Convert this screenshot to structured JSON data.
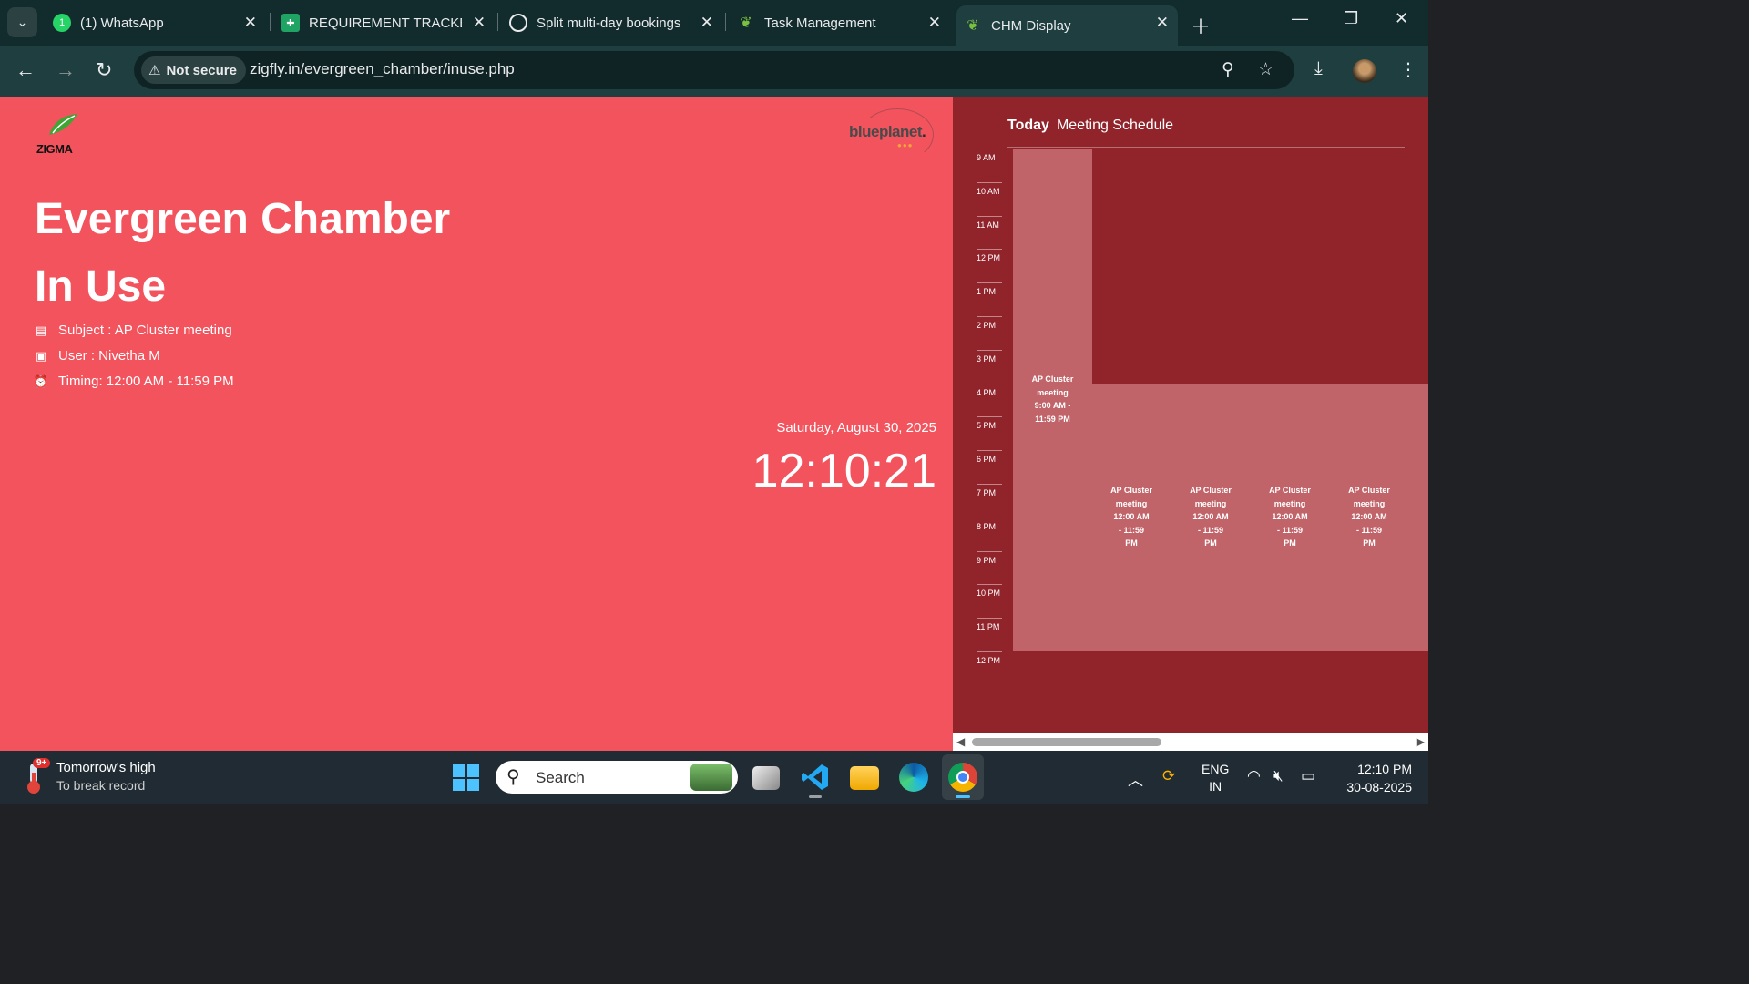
{
  "browser": {
    "tabs": [
      {
        "label": "(1) WhatsApp",
        "icon": "whatsapp-icon",
        "active": false
      },
      {
        "label": "REQUIREMENT TRACKER",
        "icon": "sheets-icon",
        "active": false
      },
      {
        "label": "Split multi-day bookings",
        "icon": "openai-icon",
        "active": false
      },
      {
        "label": "Task Management",
        "icon": "leaf-icon",
        "active": false
      },
      {
        "label": "CHM Display",
        "icon": "leaf-icon",
        "active": true
      }
    ],
    "security_label": "Not secure",
    "url": "zigfly.in/evergreen_chamber/inuse.php"
  },
  "page": {
    "brand_left": "ZIGMA",
    "brand_right": "blueplanet",
    "brand_right_dot": ".",
    "room_name": "Evergreen Chamber",
    "status": "In Use",
    "subject": "Subject : AP Cluster meeting",
    "user": "User : Nivetha M",
    "timing": "Timing: 12:00 AM - 11:59 PM",
    "date": "Saturday, August 30, 2025",
    "time": "12:10:21"
  },
  "schedule": {
    "today_label": "Today",
    "title": "Meeting Schedule",
    "hours": [
      "9 AM",
      "10 AM",
      "11 AM",
      "12 PM",
      "1 PM",
      "2 PM",
      "3 PM",
      "4 PM",
      "5 PM",
      "6 PM",
      "7 PM",
      "8 PM",
      "9 PM",
      "10 PM",
      "11 PM",
      "12 PM"
    ],
    "events": [
      {
        "title": "AP Cluster meeting",
        "time": "9:00 AM - 11:59 PM",
        "lines": [
          "AP Cluster",
          "meeting",
          "9:00 AM -",
          "11:59 PM"
        ]
      },
      {
        "title": "AP Cluster meeting",
        "time": "12:00 AM - 11:59 PM",
        "lines": [
          "AP Cluster",
          "meeting",
          "12:00 AM",
          "- 11:59",
          "PM"
        ]
      },
      {
        "title": "AP Cluster meeting",
        "time": "12:00 AM - 11:59 PM",
        "lines": [
          "AP Cluster",
          "meeting",
          "12:00 AM",
          "- 11:59",
          "PM"
        ]
      },
      {
        "title": "AP Cluster meeting",
        "time": "12:00 AM - 11:59 PM",
        "lines": [
          "AP Cluster",
          "meeting",
          "12:00 AM",
          "- 11:59",
          "PM"
        ]
      },
      {
        "title": "AP Cluster meeting",
        "time": "12:00 AM - 11:59 PM",
        "lines": [
          "AP Cluster",
          "meeting",
          "12:00 AM",
          "- 11:59",
          "PM"
        ]
      }
    ]
  },
  "taskbar": {
    "weather_badge": "9+",
    "weather_title": "Tomorrow's high",
    "weather_sub": "To break record",
    "search_placeholder": "Search",
    "lang_line1": "ENG",
    "lang_line2": "IN",
    "time": "12:10 PM",
    "date": "30-08-2025"
  },
  "colors": {
    "page_bg": "#f2535d",
    "schedule_bg": "#91232b",
    "event_bg": "#c06469"
  }
}
